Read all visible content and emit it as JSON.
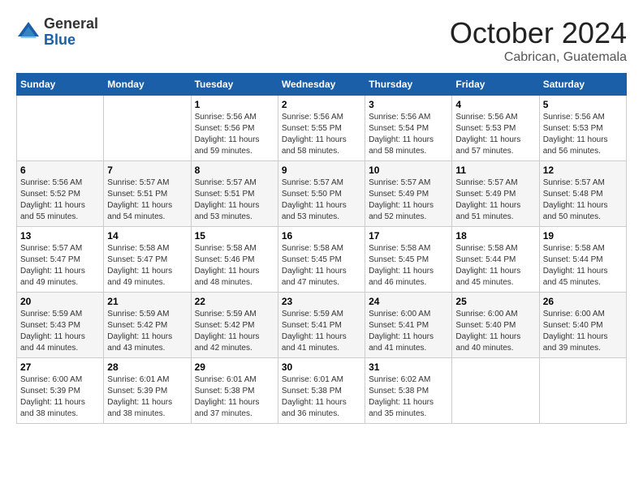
{
  "logo": {
    "general": "General",
    "blue": "Blue"
  },
  "header": {
    "month": "October 2024",
    "location": "Cabrican, Guatemala"
  },
  "weekdays": [
    "Sunday",
    "Monday",
    "Tuesday",
    "Wednesday",
    "Thursday",
    "Friday",
    "Saturday"
  ],
  "weeks": [
    [
      {
        "day": "",
        "info": ""
      },
      {
        "day": "",
        "info": ""
      },
      {
        "day": "1",
        "info": "Sunrise: 5:56 AM\nSunset: 5:56 PM\nDaylight: 11 hours and 59 minutes."
      },
      {
        "day": "2",
        "info": "Sunrise: 5:56 AM\nSunset: 5:55 PM\nDaylight: 11 hours and 58 minutes."
      },
      {
        "day": "3",
        "info": "Sunrise: 5:56 AM\nSunset: 5:54 PM\nDaylight: 11 hours and 58 minutes."
      },
      {
        "day": "4",
        "info": "Sunrise: 5:56 AM\nSunset: 5:53 PM\nDaylight: 11 hours and 57 minutes."
      },
      {
        "day": "5",
        "info": "Sunrise: 5:56 AM\nSunset: 5:53 PM\nDaylight: 11 hours and 56 minutes."
      }
    ],
    [
      {
        "day": "6",
        "info": "Sunrise: 5:56 AM\nSunset: 5:52 PM\nDaylight: 11 hours and 55 minutes."
      },
      {
        "day": "7",
        "info": "Sunrise: 5:57 AM\nSunset: 5:51 PM\nDaylight: 11 hours and 54 minutes."
      },
      {
        "day": "8",
        "info": "Sunrise: 5:57 AM\nSunset: 5:51 PM\nDaylight: 11 hours and 53 minutes."
      },
      {
        "day": "9",
        "info": "Sunrise: 5:57 AM\nSunset: 5:50 PM\nDaylight: 11 hours and 53 minutes."
      },
      {
        "day": "10",
        "info": "Sunrise: 5:57 AM\nSunset: 5:49 PM\nDaylight: 11 hours and 52 minutes."
      },
      {
        "day": "11",
        "info": "Sunrise: 5:57 AM\nSunset: 5:49 PM\nDaylight: 11 hours and 51 minutes."
      },
      {
        "day": "12",
        "info": "Sunrise: 5:57 AM\nSunset: 5:48 PM\nDaylight: 11 hours and 50 minutes."
      }
    ],
    [
      {
        "day": "13",
        "info": "Sunrise: 5:57 AM\nSunset: 5:47 PM\nDaylight: 11 hours and 49 minutes."
      },
      {
        "day": "14",
        "info": "Sunrise: 5:58 AM\nSunset: 5:47 PM\nDaylight: 11 hours and 49 minutes."
      },
      {
        "day": "15",
        "info": "Sunrise: 5:58 AM\nSunset: 5:46 PM\nDaylight: 11 hours and 48 minutes."
      },
      {
        "day": "16",
        "info": "Sunrise: 5:58 AM\nSunset: 5:45 PM\nDaylight: 11 hours and 47 minutes."
      },
      {
        "day": "17",
        "info": "Sunrise: 5:58 AM\nSunset: 5:45 PM\nDaylight: 11 hours and 46 minutes."
      },
      {
        "day": "18",
        "info": "Sunrise: 5:58 AM\nSunset: 5:44 PM\nDaylight: 11 hours and 45 minutes."
      },
      {
        "day": "19",
        "info": "Sunrise: 5:58 AM\nSunset: 5:44 PM\nDaylight: 11 hours and 45 minutes."
      }
    ],
    [
      {
        "day": "20",
        "info": "Sunrise: 5:59 AM\nSunset: 5:43 PM\nDaylight: 11 hours and 44 minutes."
      },
      {
        "day": "21",
        "info": "Sunrise: 5:59 AM\nSunset: 5:42 PM\nDaylight: 11 hours and 43 minutes."
      },
      {
        "day": "22",
        "info": "Sunrise: 5:59 AM\nSunset: 5:42 PM\nDaylight: 11 hours and 42 minutes."
      },
      {
        "day": "23",
        "info": "Sunrise: 5:59 AM\nSunset: 5:41 PM\nDaylight: 11 hours and 41 minutes."
      },
      {
        "day": "24",
        "info": "Sunrise: 6:00 AM\nSunset: 5:41 PM\nDaylight: 11 hours and 41 minutes."
      },
      {
        "day": "25",
        "info": "Sunrise: 6:00 AM\nSunset: 5:40 PM\nDaylight: 11 hours and 40 minutes."
      },
      {
        "day": "26",
        "info": "Sunrise: 6:00 AM\nSunset: 5:40 PM\nDaylight: 11 hours and 39 minutes."
      }
    ],
    [
      {
        "day": "27",
        "info": "Sunrise: 6:00 AM\nSunset: 5:39 PM\nDaylight: 11 hours and 38 minutes."
      },
      {
        "day": "28",
        "info": "Sunrise: 6:01 AM\nSunset: 5:39 PM\nDaylight: 11 hours and 38 minutes."
      },
      {
        "day": "29",
        "info": "Sunrise: 6:01 AM\nSunset: 5:38 PM\nDaylight: 11 hours and 37 minutes."
      },
      {
        "day": "30",
        "info": "Sunrise: 6:01 AM\nSunset: 5:38 PM\nDaylight: 11 hours and 36 minutes."
      },
      {
        "day": "31",
        "info": "Sunrise: 6:02 AM\nSunset: 5:38 PM\nDaylight: 11 hours and 35 minutes."
      },
      {
        "day": "",
        "info": ""
      },
      {
        "day": "",
        "info": ""
      }
    ]
  ]
}
